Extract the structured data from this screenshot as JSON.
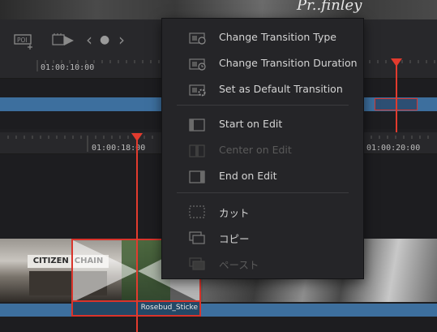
{
  "viewer": {
    "sign_text": "Pr..finley"
  },
  "toolbar": {
    "poi_label": "POI",
    "prev_symbol": "‹",
    "next_symbol": "›",
    "dot_symbol": "●"
  },
  "timeline": {
    "upper_timecode": "01:00:10:00",
    "lower_timecodes": [
      "01:00:18:00",
      "01:00:20:00"
    ],
    "clip_name": "Rosebud_Sticke",
    "storefront_text": "CITIZEN  CHAIN"
  },
  "menu": {
    "items": [
      {
        "label": "Change Transition Type",
        "icon": "change-transition-type-icon",
        "enabled": true
      },
      {
        "label": "Change Transition Duration",
        "icon": "transition-duration-icon",
        "enabled": true
      },
      {
        "label": "Set as Default Transition",
        "icon": "default-transition-icon",
        "enabled": true
      },
      {
        "label": "Start on Edit",
        "icon": "start-on-edit-icon",
        "enabled": true
      },
      {
        "label": "Center on Edit",
        "icon": "center-on-edit-icon",
        "enabled": false
      },
      {
        "label": "End on Edit",
        "icon": "end-on-edit-icon",
        "enabled": true
      },
      {
        "label": "カット",
        "icon": "cut-icon",
        "enabled": true
      },
      {
        "label": "コピー",
        "icon": "copy-icon",
        "enabled": true
      },
      {
        "label": "ペースト",
        "icon": "paste-icon",
        "enabled": false
      }
    ]
  },
  "colors": {
    "playhead": "#e23b2e",
    "clip_blue": "#3d6f9e",
    "selection_red": "#d9342b"
  }
}
